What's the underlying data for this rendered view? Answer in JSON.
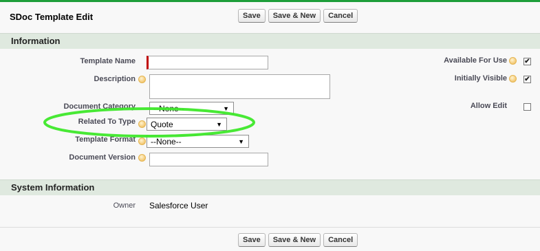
{
  "title": "SDoc Template Edit",
  "buttons": {
    "save": "Save",
    "save_new": "Save & New",
    "cancel": "Cancel"
  },
  "sections": {
    "information": "Information",
    "system_information": "System Information"
  },
  "fields": {
    "template_name": {
      "label": "Template Name",
      "value": ""
    },
    "description": {
      "label": "Description",
      "value": ""
    },
    "document_category": {
      "label": "Document Category",
      "value": "--None--"
    },
    "related_to_type": {
      "label": "Related To Type",
      "value": "Quote"
    },
    "template_format": {
      "label": "Template Format",
      "value": "--None--"
    },
    "document_version": {
      "label": "Document Version",
      "value": ""
    },
    "available_for_use": {
      "label": "Available For Use",
      "checked": true
    },
    "initially_visible": {
      "label": "Initially Visible",
      "checked": true
    },
    "allow_edit": {
      "label": "Allow Edit",
      "checked": false
    }
  },
  "system": {
    "owner_label": "Owner",
    "owner_value": "Salesforce User"
  },
  "colors": {
    "highlight_oval": "#3ee82a",
    "required_bar": "#c00000",
    "section_bg": "#dfe9df"
  }
}
